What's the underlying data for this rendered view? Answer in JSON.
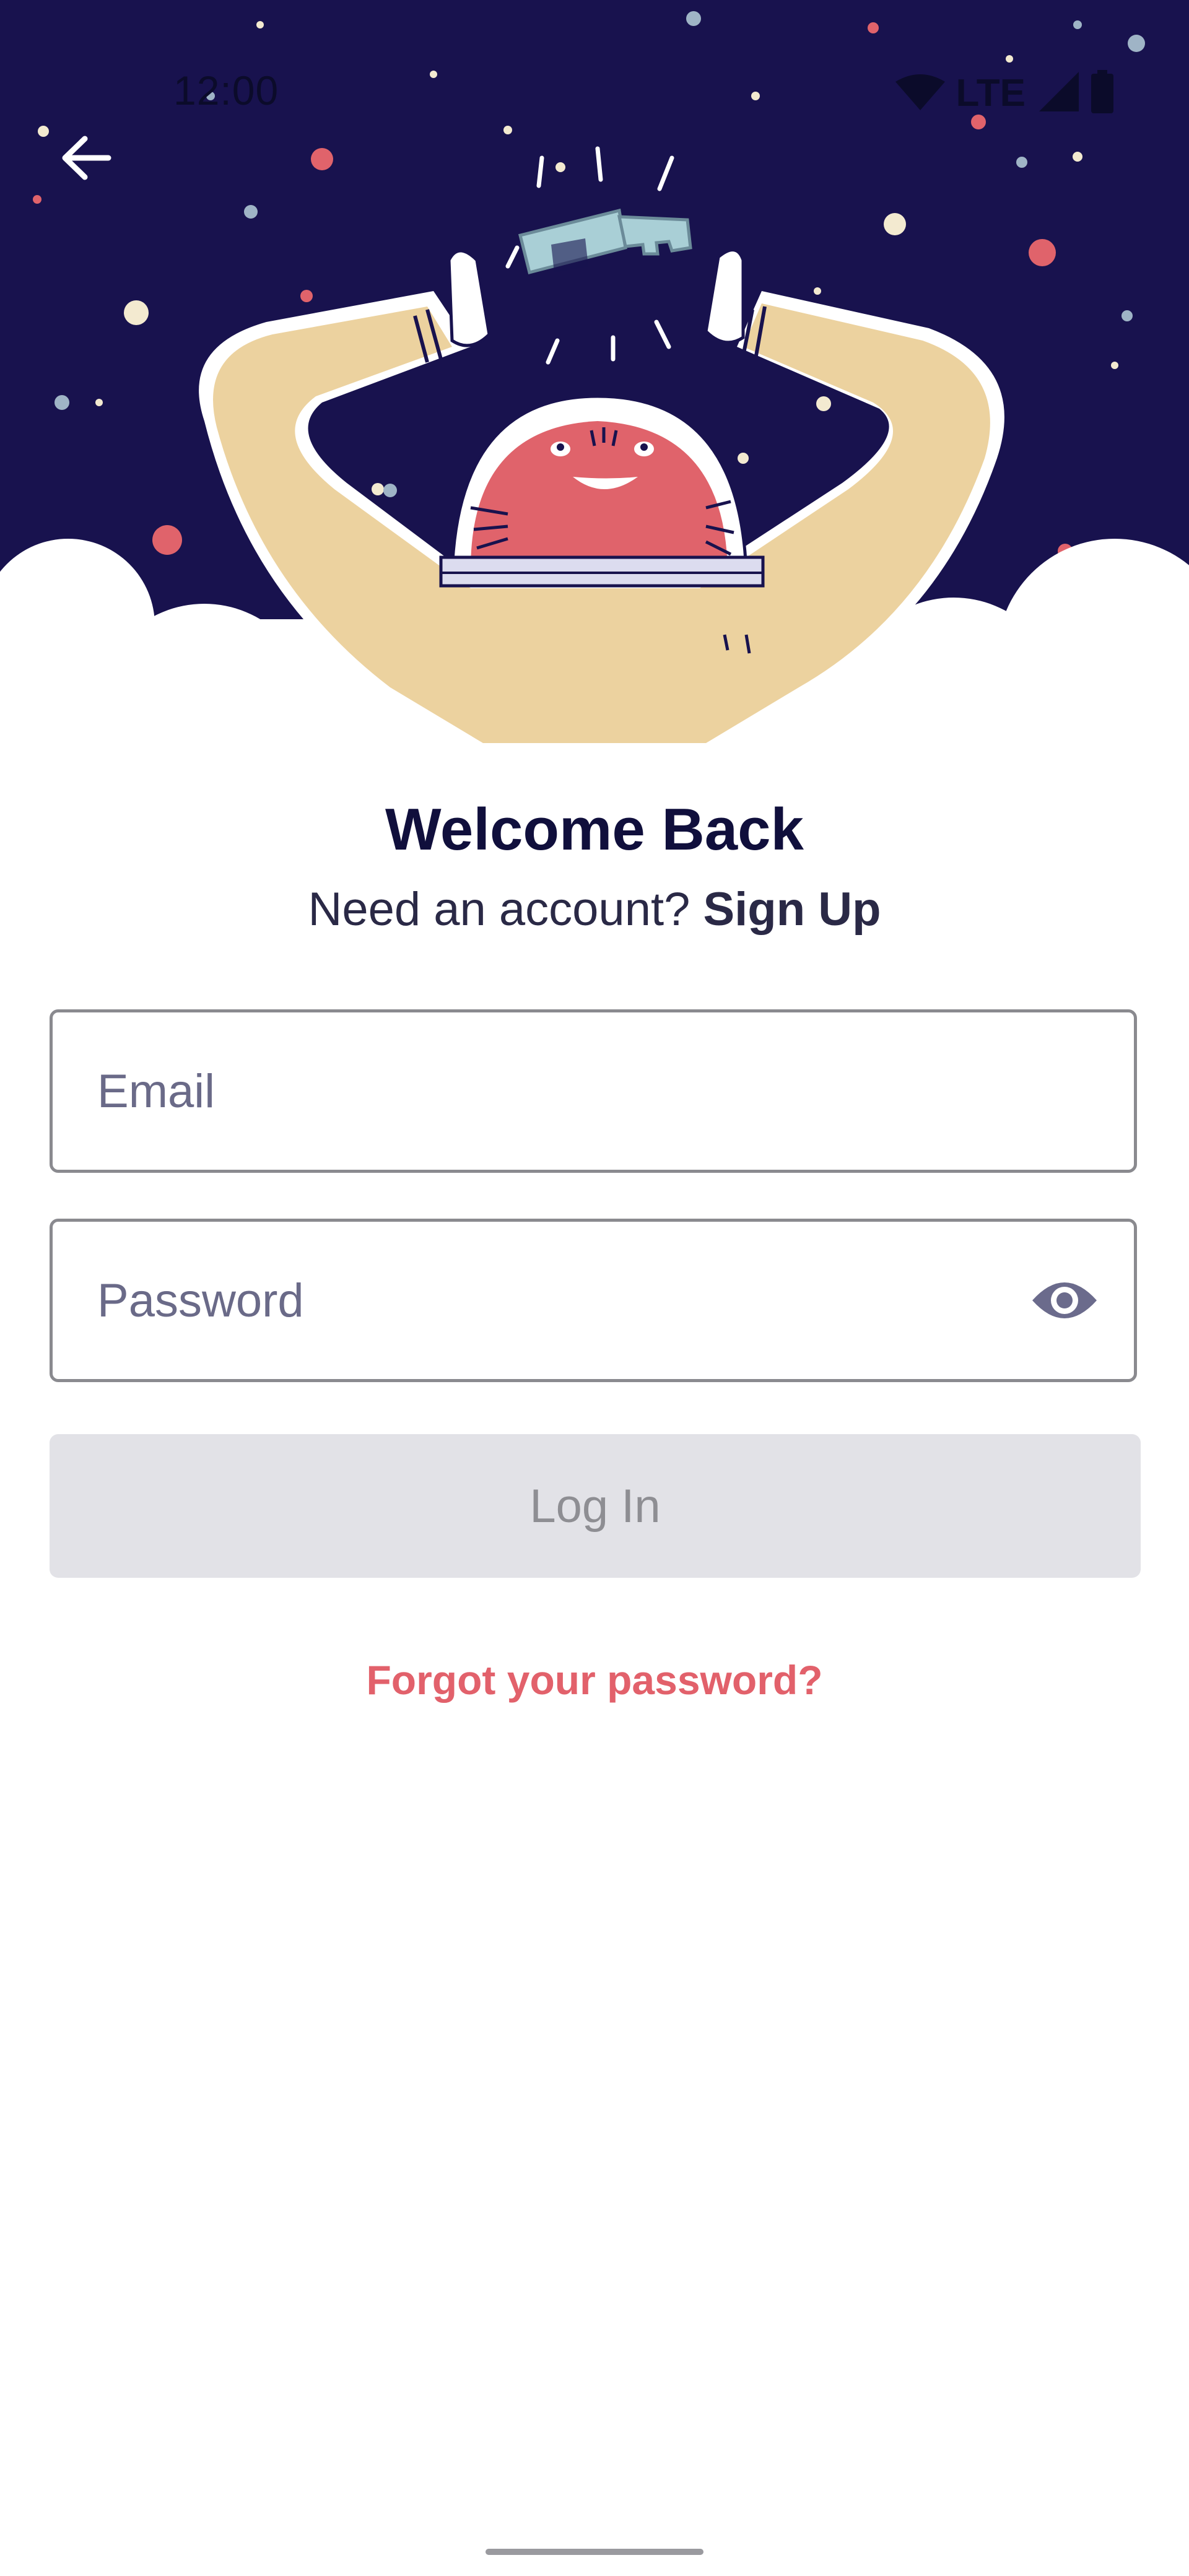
{
  "status_bar": {
    "time": "12:00",
    "network": "LTE",
    "icons": [
      "wifi-icon",
      "cell-signal-icon",
      "battery-icon"
    ]
  },
  "nav": {
    "back_icon": "arrow-left-icon"
  },
  "hero": {
    "illustration": "astronaut-holding-key",
    "colors": {
      "sky": "#18124e",
      "cloud": "#ffffff",
      "suit": "#ecd29f",
      "face": "#e0636b",
      "key": "#a9cfd6"
    }
  },
  "welcome": {
    "title": "Welcome Back",
    "prompt": "Need an account?",
    "signup_label": "Sign Up"
  },
  "form": {
    "email": {
      "placeholder": "Email",
      "value": ""
    },
    "password": {
      "placeholder": "Password",
      "value": "",
      "toggle_icon": "eye-icon"
    },
    "login_label": "Log In",
    "forgot_label": "Forgot your password?"
  },
  "colors": {
    "title": "#100f3c",
    "accent": "#e2616b",
    "button_disabled_bg": "#e2e2e7",
    "button_disabled_text": "#8e8e93"
  }
}
